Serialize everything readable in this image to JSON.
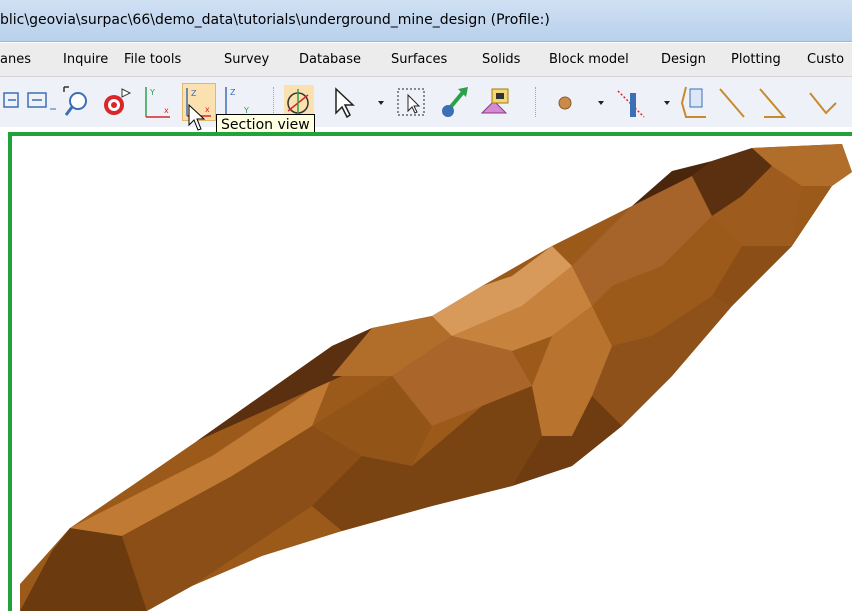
{
  "window": {
    "title": "blic\\geovia\\surpac\\66\\demo_data\\tutorials\\underground_mine_design (Profile:)"
  },
  "menu": {
    "items": [
      "anes",
      "Inquire",
      "File tools",
      "Survey",
      "Database",
      "Surfaces",
      "Solids",
      "Block model",
      "Design",
      "Plotting",
      "Custo"
    ]
  },
  "toolbar": {
    "tooltip": "Section view",
    "active_tool": "section-view",
    "icons": [
      "plane-insert-icon",
      "plane-icon",
      "zoom-extents-icon",
      "target-icon",
      "plan-view-icon",
      "section-view-icon",
      "long-section-view-icon",
      "rotate-view-icon",
      "select-arrow-icon",
      "select-point-icon",
      "transform-icon",
      "graphics-icon",
      "point-icon",
      "segment-split-icon",
      "string-icon",
      "line-icon",
      "triangle-icon",
      "arc-icon"
    ]
  },
  "viewport": {
    "object": "orebody-solid",
    "solid_color": "#9b5a1a",
    "border_color": "#22a23a"
  }
}
